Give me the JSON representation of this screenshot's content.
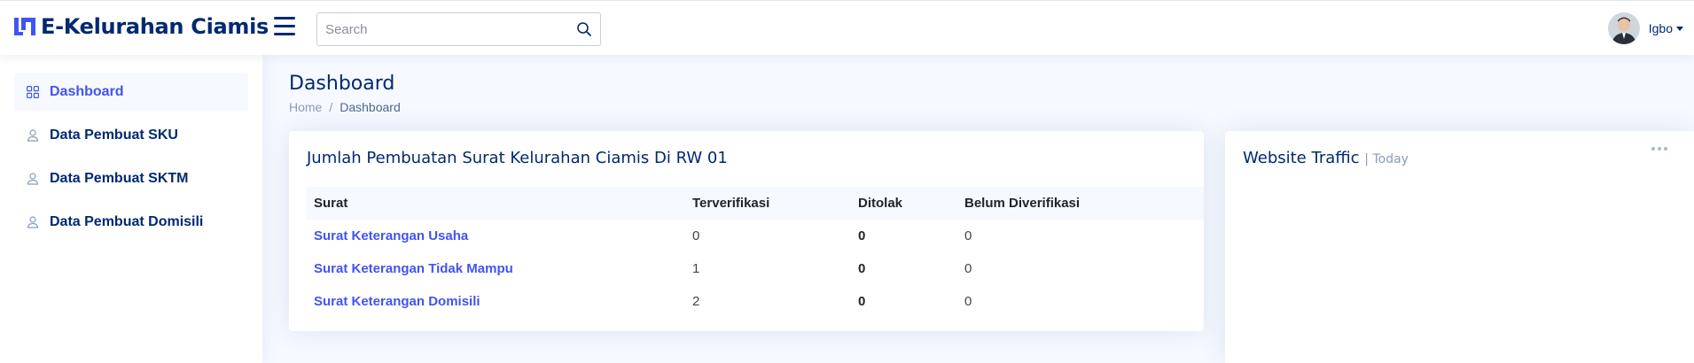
{
  "app": {
    "title": "E-Kelurahan Ciamis"
  },
  "header": {
    "search_placeholder": "Search",
    "user_name": "Igbo"
  },
  "sidebar": {
    "items": [
      {
        "label": "Dashboard",
        "icon": "grid-icon",
        "active": true
      },
      {
        "label": "Data Pembuat SKU",
        "icon": "person-icon",
        "active": false
      },
      {
        "label": "Data Pembuat SKTM",
        "icon": "person-icon",
        "active": false
      },
      {
        "label": "Data Pembuat Domisili",
        "icon": "person-icon",
        "active": false
      }
    ]
  },
  "page": {
    "title": "Dashboard",
    "breadcrumb": {
      "home": "Home",
      "separator": "/",
      "current": "Dashboard"
    }
  },
  "letters_card": {
    "title": "Jumlah Pembuatan Surat Kelurahan Ciamis Di RW 01",
    "columns": [
      "Surat",
      "Terverifikasi",
      "Ditolak",
      "Belum Diverifikasi"
    ],
    "rows": [
      {
        "surat": "Surat Keterangan Usaha",
        "terverifikasi": "0",
        "ditolak": "0",
        "belum": "0"
      },
      {
        "surat": "Surat Keterangan Tidak Mampu",
        "terverifikasi": "1",
        "ditolak": "0",
        "belum": "0"
      },
      {
        "surat": "Surat Keterangan Domisili",
        "terverifikasi": "2",
        "ditolak": "0",
        "belum": "0"
      }
    ]
  },
  "traffic_card": {
    "title": "Website Traffic",
    "subtitle": "| Today"
  },
  "colors": {
    "brand": "#012970",
    "accent": "#4154f1",
    "background": "#f6f9ff",
    "muted": "#899bbd"
  }
}
